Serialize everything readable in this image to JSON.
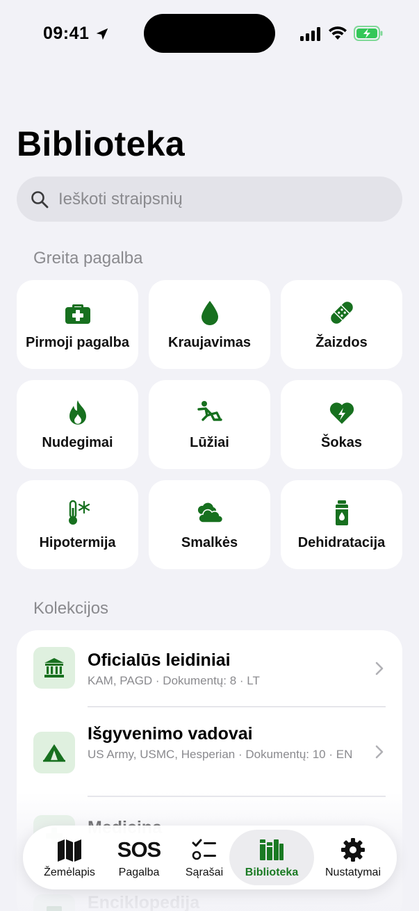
{
  "status_bar": {
    "time": "09:41"
  },
  "page": {
    "title": "Biblioteka"
  },
  "search": {
    "placeholder": "Ieškoti straipsnių"
  },
  "quick_help": {
    "header": "Greita pagalba",
    "tiles": [
      {
        "label": "Pirmoji pagalba",
        "icon": "first-aid-kit-icon"
      },
      {
        "label": "Kraujavimas",
        "icon": "blood-drop-icon"
      },
      {
        "label": "Žaizdos",
        "icon": "bandage-icon"
      },
      {
        "label": "Nudegimai",
        "icon": "flame-icon"
      },
      {
        "label": "Lūžiai",
        "icon": "falling-person-icon"
      },
      {
        "label": "Šokas",
        "icon": "heart-bolt-icon"
      },
      {
        "label": "Hipotermija",
        "icon": "thermometer-snowflake-icon"
      },
      {
        "label": "Smalkės",
        "icon": "smoke-cloud-icon"
      },
      {
        "label": "Dehidratacija",
        "icon": "water-bottle-icon"
      }
    ]
  },
  "collections": {
    "header": "Kolekcijos",
    "items": [
      {
        "title": "Oficialūs leidiniai",
        "subtitle": "KAM, PAGD · Dokumentų: 8 · LT",
        "icon": "government-building-icon"
      },
      {
        "title": "Išgyvenimo vadovai",
        "subtitle": "US Army, USMC, Hesperian · Dokumentų: 10 · EN",
        "icon": "tent-icon"
      },
      {
        "title": "Medicina",
        "subtitle": "",
        "icon": "medical-icon"
      },
      {
        "title": "Enciklopedija",
        "subtitle": "",
        "icon": "book-icon"
      }
    ]
  },
  "tabbar": {
    "tabs": [
      {
        "label": "Žemėlapis",
        "icon": "map-icon"
      },
      {
        "label": "Pagalba",
        "icon": "sos-icon",
        "glyph": "SOS"
      },
      {
        "label": "Sąrašai",
        "icon": "checklist-icon"
      },
      {
        "label": "Biblioteka",
        "icon": "books-icon",
        "active": true
      },
      {
        "label": "Nustatymai",
        "icon": "gear-icon"
      }
    ]
  },
  "colors": {
    "accent": "#1a7a23",
    "icon_green": "#17701f",
    "background": "#f2f2f7",
    "icon_box": "#dff0df"
  }
}
